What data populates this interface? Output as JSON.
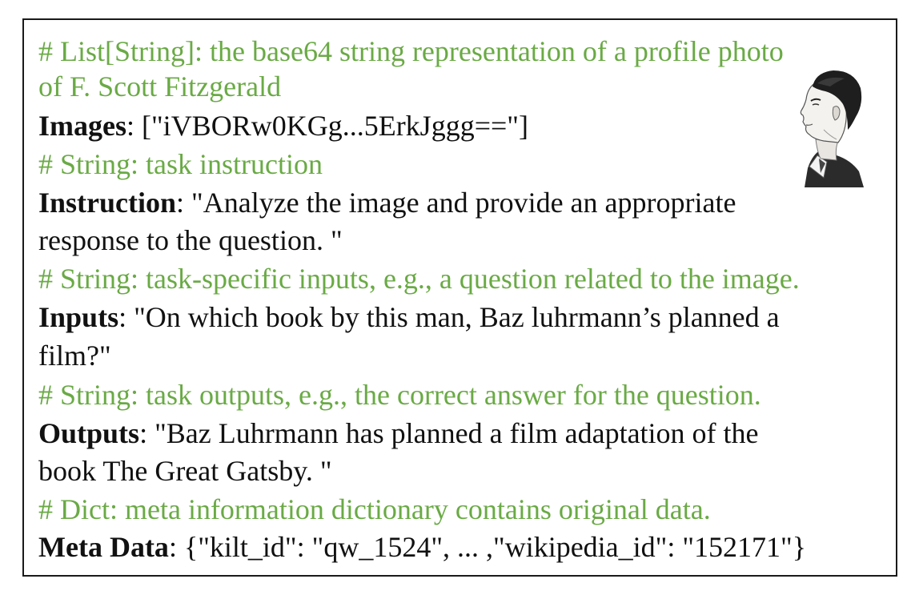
{
  "record": {
    "images_comment_1": "# List[String]: the base64 string representation of a profile photo",
    "images_comment_2": "of F. Scott Fitzgerald",
    "images_key": "Images",
    "images_value": ": [\"iVBORw0KGg...5ErkJggg==\"]",
    "instruction_comment": "# String: task instruction",
    "instruction_key": "Instruction",
    "instruction_value_1": ": \"Analyze the image and provide an appropriate",
    "instruction_value_2": "response to the question. \"",
    "inputs_comment": "# String: task-specific inputs, e.g., a question related to the image.",
    "inputs_key": "Inputs",
    "inputs_value_1": ": \"On which book by this man, Baz luhrmann’s planned a",
    "inputs_value_2": "film?\"",
    "outputs_comment": "# String: task outputs, e.g., the correct answer for the question.",
    "outputs_key": "Outputs",
    "outputs_value_1": ": \"Baz Luhrmann has planned a film adaptation of the",
    "outputs_value_2": "book The Great Gatsby. \"",
    "meta_comment": "# Dict: meta information dictionary contains original data.",
    "meta_key": "Meta Data",
    "meta_value": ": {\"kilt_id\": \"qw_1524\", ... ,\"wikipedia_id\": \"152171\"}"
  },
  "colors": {
    "comment": "#6aaa45",
    "text": "#111111",
    "border": "#1a1a1a"
  },
  "portrait": {
    "icon": "profile-portrait-icon"
  }
}
